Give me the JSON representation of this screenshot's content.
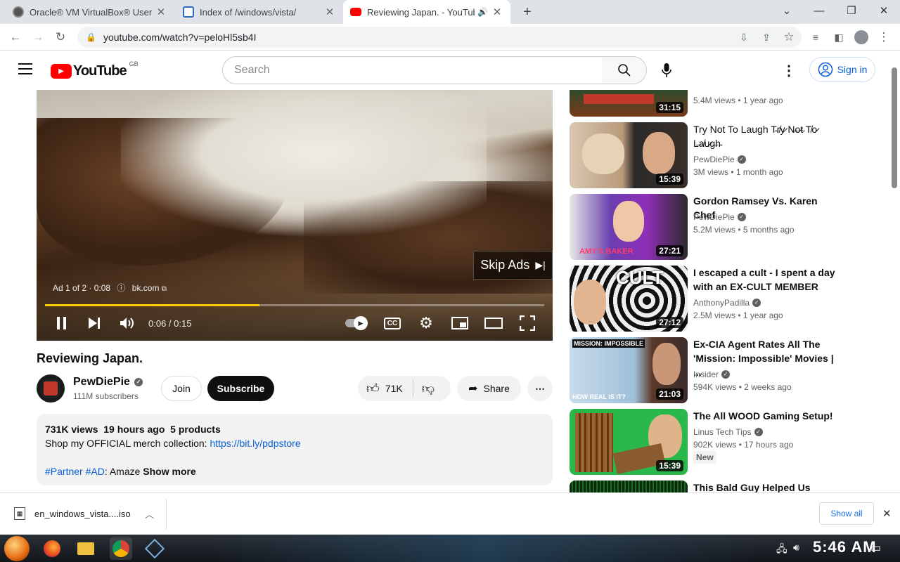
{
  "browser": {
    "tabs": [
      {
        "title": "Oracle® VM VirtualBox® User",
        "icon": "virtualbox-icon"
      },
      {
        "title": "Index of /windows/vista/",
        "icon": "ie-page-icon"
      },
      {
        "title": "Reviewing Japan. - YouTube",
        "icon": "youtube-icon"
      }
    ],
    "new_tab": "+",
    "url": "youtube.com/watch?v=peloHl5sb4I"
  },
  "yt": {
    "logo_text": "YouTube",
    "region": "GB",
    "search_placeholder": "Search",
    "sign_in": "Sign in"
  },
  "player": {
    "skip_label": "Skip Ads",
    "ad_info": "Ad 1 of 2 · 0:08",
    "ad_domain": "bk.com",
    "time": "0:06 / 0:15",
    "progress": 0.43
  },
  "video": {
    "title": "Reviewing Japan.",
    "channel": "PewDiePie",
    "subscribers": "111M subscribers",
    "join": "Join",
    "subscribe": "Subscribe",
    "likes": "71K",
    "share": "Share",
    "desc": {
      "stats": "731K views  19 hours ago  5 products",
      "line1": "Shop my OFFICIAL merch collection: ",
      "link": "https://bit.ly/pdpstore",
      "tags": "#Partner #AD",
      "tail": ": Amaze ",
      "more": "Show more"
    }
  },
  "recs": [
    {
      "title": "",
      "channel": "",
      "meta": "5.4M views  • 1 year ago",
      "dur": "31:15"
    },
    {
      "title": "Try Not To Laugh T̴r̸y̷ N̶o̷t̴ T̸o̷ L̶a̸u̷g̶h̴",
      "channel": "PewDiePie",
      "meta": "3M views  • 1 month ago",
      "dur": "15:39"
    },
    {
      "title": "Gordon Ramsey Vs. Karen Chef",
      "channel": "PewDiePie",
      "meta": "5.2M views  • 5 months ago",
      "dur": "27:21",
      "thumb_text": "AMY'S BAKER"
    },
    {
      "title": "I escaped a cult - I spent a day with an EX-CULT MEMBER",
      "channel": "AnthonyPadilla",
      "meta": "2.5M views  • 1 year ago",
      "dur": "27:12",
      "thumb_text": "CULT"
    },
    {
      "title": "Ex-CIA Agent Rates All The 'Mission: Impossible' Movies | ...",
      "channel": "Insider",
      "meta": "594K views  • 2 weeks ago",
      "dur": "21:03",
      "thumb_text": "MISSION: IMPOSSIBLE",
      "thumb_sub": "HOW REAL IS IT?"
    },
    {
      "title": "The All WOOD Gaming Setup!",
      "channel": "Linus Tech Tips",
      "meta": "902K views  • 17 hours ago",
      "dur": "15:39",
      "badge": "New"
    },
    {
      "title": "This Bald Guy Helped Us",
      "channel": "",
      "meta": "",
      "dur": ""
    }
  ],
  "download": {
    "file": "en_windows_vista....iso",
    "show_all": "Show all"
  },
  "taskbar": {
    "clock": "5:46 AM"
  },
  "colors": {
    "yt_red": "#ff0000",
    "link_blue": "#065fd4",
    "progress": "#ffcc00"
  }
}
